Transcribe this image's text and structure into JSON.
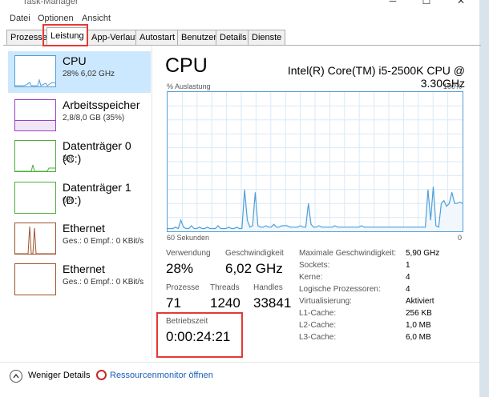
{
  "window": {
    "title": "Task-Manager"
  },
  "menu": [
    "Datei",
    "Optionen",
    "Ansicht"
  ],
  "tabs": [
    "Prozesse",
    "Leistung",
    "App-Verlauf",
    "Autostart",
    "Benutzer",
    "Details",
    "Dienste"
  ],
  "sidebar": [
    {
      "name": "CPU",
      "sub": "28% 6,02 GHz"
    },
    {
      "name": "Arbeitsspeicher",
      "sub": "2,8/8,0 GB (35%)"
    },
    {
      "name": "Datenträger 0 (C:)",
      "sub": "3%"
    },
    {
      "name": "Datenträger 1 (D:)",
      "sub": "0%"
    },
    {
      "name": "Ethernet",
      "sub": "Ges.: 0 Empf.: 0 KBit/s"
    },
    {
      "name": "Ethernet",
      "sub": "Ges.: 0 Empf.: 0 KBit/s"
    }
  ],
  "cpu": {
    "title": "CPU",
    "model": "Intel(R) Core(TM) i5-2500K CPU @ 3.30GHz",
    "graph_label": "% Auslastung",
    "graph_max": "100%",
    "graph_time": "60 Sekunden",
    "graph_min": "0",
    "usage_series": [
      2,
      2,
      2,
      3,
      2,
      8,
      3,
      2,
      2,
      4,
      2,
      2,
      3,
      2,
      2,
      3,
      2,
      2,
      2,
      4,
      2,
      2,
      2,
      3,
      2,
      2,
      3,
      2,
      2,
      30,
      8,
      3,
      4,
      28,
      4,
      3,
      3,
      4,
      3,
      3,
      5,
      3,
      3,
      4,
      4,
      4,
      3,
      3,
      3,
      3,
      4,
      3,
      3,
      20,
      5,
      3,
      3,
      4,
      3,
      3,
      3,
      3,
      3,
      4,
      3,
      3,
      3,
      3,
      3,
      3,
      3,
      3,
      3,
      4,
      3,
      3,
      3,
      3,
      3,
      3,
      3,
      3,
      3,
      3,
      3,
      3,
      3,
      3,
      3,
      3,
      3,
      3,
      3,
      3,
      3,
      3,
      3,
      3,
      30,
      8,
      32,
      4,
      3,
      20,
      22,
      18,
      20,
      28,
      20,
      20,
      21,
      20
    ],
    "stats": {
      "verwendung_label": "Verwendung",
      "verwendung": "28%",
      "geschw_label": "Geschwindigkeit",
      "geschw": "6,02 GHz",
      "prozesse_label": "Prozesse",
      "prozesse": "71",
      "threads_label": "Threads",
      "threads": "1240",
      "handles_label": "Handles",
      "handles": "33841",
      "betrieb_label": "Betriebszeit",
      "betrieb": "0:00:24:21"
    },
    "props": [
      {
        "label": "Maximale Geschwindigkeit:",
        "value": "5,90 GHz"
      },
      {
        "label": "Sockets:",
        "value": "1"
      },
      {
        "label": "Kerne:",
        "value": "4"
      },
      {
        "label": "Logische Prozessoren:",
        "value": "4"
      },
      {
        "label": "Virtualisierung:",
        "value": "Aktiviert"
      },
      {
        "label": "L1-Cache:",
        "value": "256 KB"
      },
      {
        "label": "L2-Cache:",
        "value": "1,0 MB"
      },
      {
        "label": "L3-Cache:",
        "value": "6,0 MB"
      }
    ]
  },
  "footer": {
    "less_details": "Weniger Details",
    "resmon": "Ressourcenmonitor öffnen"
  },
  "colors": {
    "cpu": "#4f9fd8",
    "memory": "#9a3fc7",
    "disk": "#4cae3a",
    "ethernet": "#a0522d",
    "highlight": "#e53935"
  }
}
